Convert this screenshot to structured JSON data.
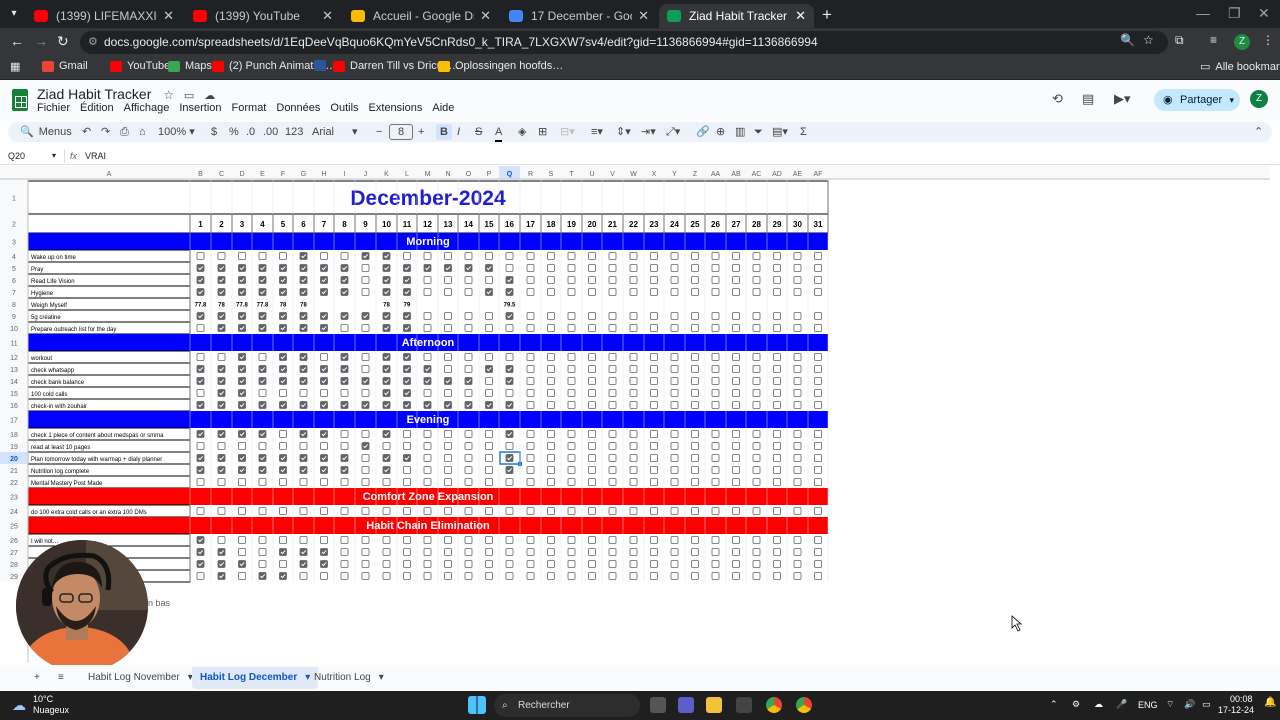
{
  "browser": {
    "tabs": [
      {
        "title": "(1399) LIFEMAXXING EVERY SU…",
        "favicon_color": "#ff0000",
        "active": false
      },
      {
        "title": "(1399) YouTube",
        "favicon_color": "#ff0000",
        "active": false
      },
      {
        "title": "Accueil - Google Drive",
        "favicon_color": "#fbbc04",
        "active": false
      },
      {
        "title": "17 December - Google Docs",
        "favicon_color": "#4285f4",
        "active": false
      },
      {
        "title": "Ziad Habit Tracker - Google She…",
        "favicon_color": "#0f9d58",
        "active": true
      }
    ],
    "url": "docs.google.com/spreadsheets/d/1EqDeeVqBquo6KQmYeV5CnRds0_k_TIRA_7LXGXW7sv4/edit?gid=1136866994#gid=1136866994",
    "profile_initial": "Z",
    "bookmarks": [
      {
        "label": "Gmail",
        "color": "#ea4335"
      },
      {
        "label": "YouTube",
        "color": "#ff0000"
      },
      {
        "label": "Maps",
        "color": "#34a853"
      },
      {
        "label": "(2) Punch Animatio…",
        "color": "#ff0000"
      },
      {
        "label": "",
        "color": "#2b579a"
      },
      {
        "label": "Darren Till vs Dricus…",
        "color": "#ff0000"
      },
      {
        "label": "Oplossingen hoofds…",
        "color": "#fbbc04"
      }
    ],
    "all_bookmarks": "Alle bookmarks"
  },
  "doc": {
    "title": "Ziad Habit Tracker",
    "menus": [
      "Fichier",
      "Édition",
      "Affichage",
      "Insertion",
      "Format",
      "Données",
      "Outils",
      "Extensions",
      "Aide"
    ],
    "share_label": "Partager",
    "avatar": "Z"
  },
  "toolbar": {
    "search_menus": "Menus",
    "zoom": "100%",
    "currency": "$",
    "percent": "%",
    "dec_less": ".0",
    "dec_more": ".00",
    "number_format": "123",
    "font": "Arial",
    "font_size": "8",
    "bold": "B",
    "italic": "I",
    "text_color": "A"
  },
  "formula_bar": {
    "cell_ref": "Q20",
    "fx": "fx",
    "value": "VRAI"
  },
  "sheet": {
    "title": "December-2024",
    "title_color": "#1f1fd1",
    "day_numbers": [
      "1",
      "2",
      "3",
      "4",
      "5",
      "6",
      "7",
      "8",
      "9",
      "10",
      "11",
      "12",
      "13",
      "14",
      "15",
      "16",
      "17",
      "18",
      "19",
      "20",
      "21",
      "22",
      "23",
      "24",
      "25",
      "26",
      "27",
      "28",
      "29",
      "30",
      "31"
    ],
    "column_letters": [
      "B",
      "C",
      "D",
      "E",
      "F",
      "G",
      "H",
      "I",
      "J",
      "K",
      "L",
      "M",
      "N",
      "O",
      "P",
      "Q",
      "R",
      "S",
      "T",
      "U",
      "V",
      "W",
      "X",
      "Y",
      "Z",
      "AA",
      "AB",
      "AC",
      "AD",
      "AE",
      "AF"
    ],
    "first_col_letter": "A",
    "selected_cell": {
      "col": "Q",
      "row": "20"
    },
    "colors": {
      "header_blue": "#0000ff",
      "header_red": "#ff0000",
      "check": "#5f6368"
    },
    "rows": [
      {
        "num": "1",
        "type": "title"
      },
      {
        "num": "2",
        "type": "days"
      },
      {
        "num": "3",
        "type": "header",
        "label": "Morning",
        "color": "#0000ff"
      },
      {
        "num": "4",
        "type": "habit",
        "label": "Wake up on time",
        "checks": "0000010011000000000000000000000"
      },
      {
        "num": "5",
        "type": "habit",
        "label": "Pray",
        "checks": "1111111101111110000000000000000"
      },
      {
        "num": "6",
        "type": "habit",
        "label": "Read Life Vision",
        "checks": "1111111101100001000000000000000"
      },
      {
        "num": "7",
        "type": "habit",
        "label": "Hygiene",
        "checks": "1111111101100011000000000000000"
      },
      {
        "num": "8",
        "type": "values",
        "label": "Weigh Myself",
        "values": [
          "77.8",
          "78",
          "77.8",
          "77.8",
          "78",
          "78",
          "",
          "",
          "",
          "78",
          "79",
          "",
          "",
          "",
          "",
          "79.5",
          "",
          "",
          "",
          "",
          "",
          "",
          "",
          "",
          "",
          "",
          "",
          "",
          "",
          "",
          ""
        ]
      },
      {
        "num": "9",
        "type": "habit",
        "label": "5g creatine",
        "checks": "1111111111100001000000000000000"
      },
      {
        "num": "10",
        "type": "habit",
        "label": "Prepare outreach list for the day",
        "checks": "0111111001100000000000000000000"
      },
      {
        "num": "11",
        "type": "header",
        "label": "Afternoon",
        "color": "#0000ff"
      },
      {
        "num": "12",
        "type": "habit",
        "label": "workout",
        "checks": "0010110101100000000000000000000"
      },
      {
        "num": "13",
        "type": "habit",
        "label": "check whatsapp",
        "checks": "1111111101110011000000000000000"
      },
      {
        "num": "14",
        "type": "habit",
        "label": "check bank balance",
        "checks": "1111111111111101000000000000000"
      },
      {
        "num": "15",
        "type": "habit",
        "label": "100 cold calls",
        "checks": "0110000001100000000000000000000"
      },
      {
        "num": "16",
        "type": "habit",
        "label": "check-in with zouhair",
        "checks": "1111111111111111000000000000000"
      },
      {
        "num": "17",
        "type": "header",
        "label": "Evening",
        "color": "#0000ff"
      },
      {
        "num": "18",
        "type": "habit",
        "label": "check 1 piece of content about medspas or smma",
        "checks": "1111011001000001000000000000000"
      },
      {
        "num": "19",
        "type": "habit",
        "label": "read at least 10 pages",
        "checks": "0000000010000000000000000000000"
      },
      {
        "num": "20",
        "type": "habit",
        "label": "Plan tomorrow today with warmap + dialy planner",
        "checks": "1111111101100001000000000000000"
      },
      {
        "num": "21",
        "type": "habit",
        "label": "Nutrition log complete",
        "checks": "1111111101000001000000000000000"
      },
      {
        "num": "22",
        "type": "habit",
        "label": "Mental Mastery Post Made",
        "checks": "0000000000000000000000000000000"
      },
      {
        "num": "23",
        "type": "header",
        "label": "Comfort Zone Expansion",
        "color": "#ff0000"
      },
      {
        "num": "24",
        "type": "habit",
        "label": "do 100 extra cold calls or an extra 100 DMs",
        "checks": "0000000000000000000000000000000"
      },
      {
        "num": "25",
        "type": "header",
        "label": "Habit Chain Elimination",
        "color": "#ff0000"
      },
      {
        "num": "26",
        "type": "habit",
        "label": "I will not…",
        "checks": "1000000000000000000000000000000"
      },
      {
        "num": "27",
        "type": "habit",
        "label": "",
        "checks": "1100111000000000000000000000000"
      },
      {
        "num": "28",
        "type": "habit",
        "label": "",
        "checks": "1110011000000000000000000000000"
      },
      {
        "num": "29",
        "type": "habit",
        "label": "",
        "checks": "0101100000000000000000000000000"
      }
    ],
    "scroll_text": "n bas"
  },
  "sheet_tabs": [
    {
      "label": "Habit Log November",
      "active": false
    },
    {
      "label": "Habit Log December",
      "active": true
    },
    {
      "label": "Nutrition Log",
      "active": false
    }
  ],
  "taskbar": {
    "weather_temp": "10°C",
    "weather_desc": "Nuageux",
    "search_placeholder": "Rechercher",
    "lang": "ENG",
    "time": "00:08",
    "date": "17-12-24"
  }
}
